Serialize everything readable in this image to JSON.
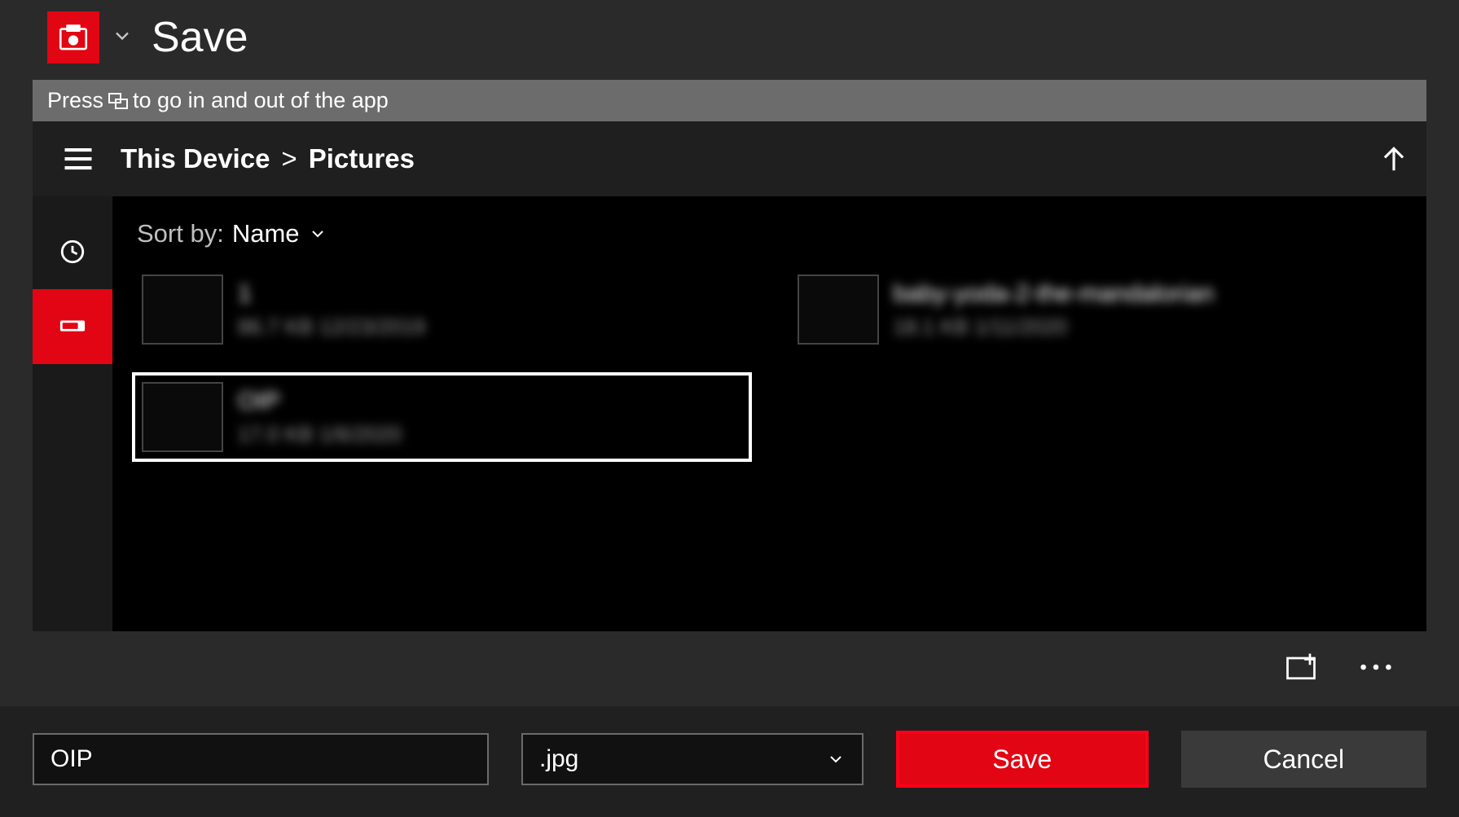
{
  "header": {
    "title": "Save"
  },
  "hint": {
    "prefix": "Press",
    "suffix": "to go in and out of the app"
  },
  "breadcrumb": {
    "root": "This Device",
    "separator": ">",
    "current": "Pictures"
  },
  "sort": {
    "label": "Sort by:",
    "value": "Name"
  },
  "files": [
    {
      "name": "1",
      "meta": "86.7 KB  12/23/2019",
      "selected": false
    },
    {
      "name": "baby-yoda-2-the-mandalorian",
      "meta": "18.1 KB  1/11/2020",
      "selected": false
    },
    {
      "name": "OIP",
      "meta": "17.0 KB  1/6/2020",
      "selected": true
    }
  ],
  "footer": {
    "filename": "OIP",
    "extension": ".jpg",
    "save_label": "Save",
    "cancel_label": "Cancel"
  }
}
